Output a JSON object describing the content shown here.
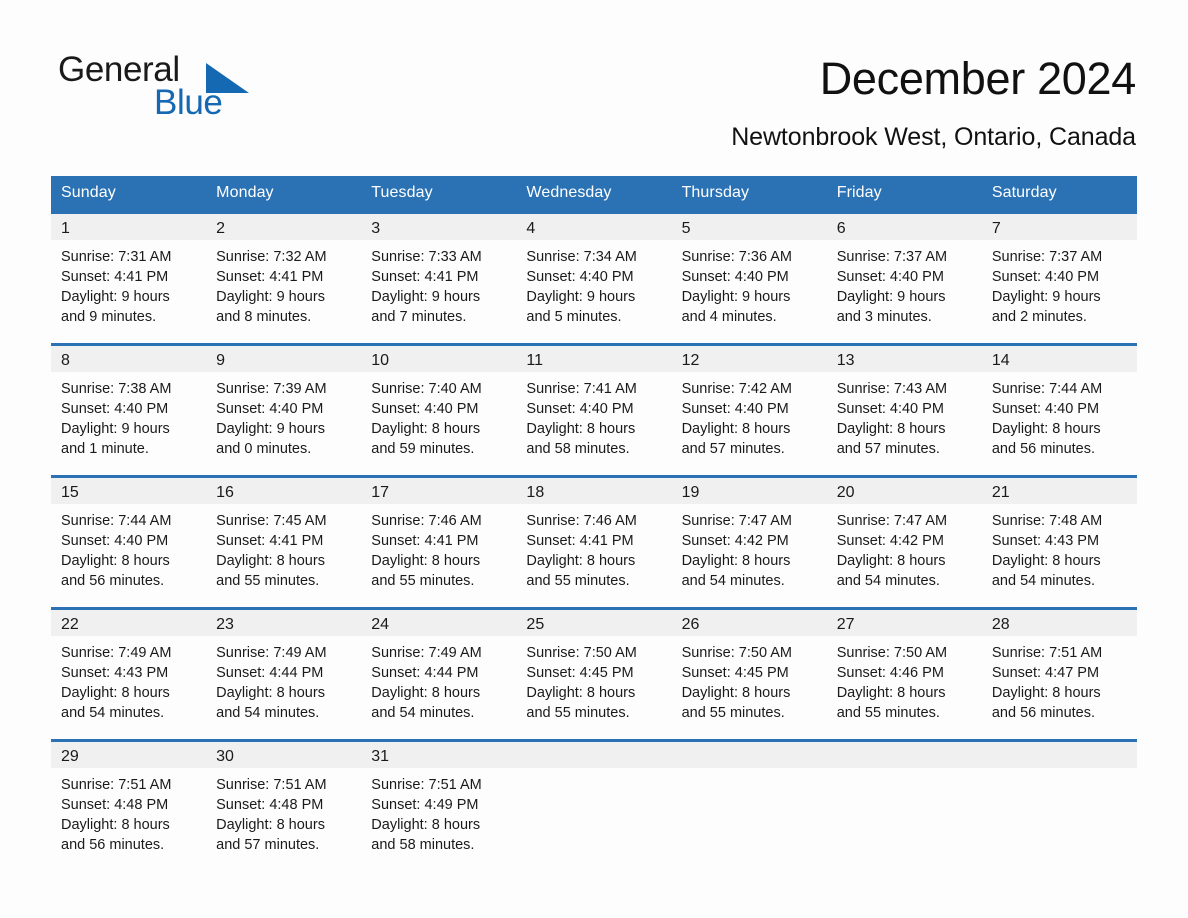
{
  "brand": {
    "name_top": "General",
    "name_bottom": "Blue",
    "triangle_icon": "blue-triangle-icon",
    "accent_color": "#1569b2"
  },
  "header": {
    "title": "December 2024",
    "subtitle": "Newtonbrook West, Ontario, Canada"
  },
  "theme": {
    "header_blue": "#2b72b4",
    "row_rule_blue": "#2b72b4",
    "daynum_band": "#f0f0f0",
    "page_background": "#fdfdfd"
  },
  "calendar": {
    "weekday_headers": [
      "Sunday",
      "Monday",
      "Tuesday",
      "Wednesday",
      "Thursday",
      "Friday",
      "Saturday"
    ],
    "weeks": [
      [
        {
          "day": "1",
          "sunrise": "Sunrise: 7:31 AM",
          "sunset": "Sunset: 4:41 PM",
          "daylight_line1": "Daylight: 9 hours",
          "daylight_line2": "and 9 minutes."
        },
        {
          "day": "2",
          "sunrise": "Sunrise: 7:32 AM",
          "sunset": "Sunset: 4:41 PM",
          "daylight_line1": "Daylight: 9 hours",
          "daylight_line2": "and 8 minutes."
        },
        {
          "day": "3",
          "sunrise": "Sunrise: 7:33 AM",
          "sunset": "Sunset: 4:41 PM",
          "daylight_line1": "Daylight: 9 hours",
          "daylight_line2": "and 7 minutes."
        },
        {
          "day": "4",
          "sunrise": "Sunrise: 7:34 AM",
          "sunset": "Sunset: 4:40 PM",
          "daylight_line1": "Daylight: 9 hours",
          "daylight_line2": "and 5 minutes."
        },
        {
          "day": "5",
          "sunrise": "Sunrise: 7:36 AM",
          "sunset": "Sunset: 4:40 PM",
          "daylight_line1": "Daylight: 9 hours",
          "daylight_line2": "and 4 minutes."
        },
        {
          "day": "6",
          "sunrise": "Sunrise: 7:37 AM",
          "sunset": "Sunset: 4:40 PM",
          "daylight_line1": "Daylight: 9 hours",
          "daylight_line2": "and 3 minutes."
        },
        {
          "day": "7",
          "sunrise": "Sunrise: 7:37 AM",
          "sunset": "Sunset: 4:40 PM",
          "daylight_line1": "Daylight: 9 hours",
          "daylight_line2": "and 2 minutes."
        }
      ],
      [
        {
          "day": "8",
          "sunrise": "Sunrise: 7:38 AM",
          "sunset": "Sunset: 4:40 PM",
          "daylight_line1": "Daylight: 9 hours",
          "daylight_line2": "and 1 minute."
        },
        {
          "day": "9",
          "sunrise": "Sunrise: 7:39 AM",
          "sunset": "Sunset: 4:40 PM",
          "daylight_line1": "Daylight: 9 hours",
          "daylight_line2": "and 0 minutes."
        },
        {
          "day": "10",
          "sunrise": "Sunrise: 7:40 AM",
          "sunset": "Sunset: 4:40 PM",
          "daylight_line1": "Daylight: 8 hours",
          "daylight_line2": "and 59 minutes."
        },
        {
          "day": "11",
          "sunrise": "Sunrise: 7:41 AM",
          "sunset": "Sunset: 4:40 PM",
          "daylight_line1": "Daylight: 8 hours",
          "daylight_line2": "and 58 minutes."
        },
        {
          "day": "12",
          "sunrise": "Sunrise: 7:42 AM",
          "sunset": "Sunset: 4:40 PM",
          "daylight_line1": "Daylight: 8 hours",
          "daylight_line2": "and 57 minutes."
        },
        {
          "day": "13",
          "sunrise": "Sunrise: 7:43 AM",
          "sunset": "Sunset: 4:40 PM",
          "daylight_line1": "Daylight: 8 hours",
          "daylight_line2": "and 57 minutes."
        },
        {
          "day": "14",
          "sunrise": "Sunrise: 7:44 AM",
          "sunset": "Sunset: 4:40 PM",
          "daylight_line1": "Daylight: 8 hours",
          "daylight_line2": "and 56 minutes."
        }
      ],
      [
        {
          "day": "15",
          "sunrise": "Sunrise: 7:44 AM",
          "sunset": "Sunset: 4:40 PM",
          "daylight_line1": "Daylight: 8 hours",
          "daylight_line2": "and 56 minutes."
        },
        {
          "day": "16",
          "sunrise": "Sunrise: 7:45 AM",
          "sunset": "Sunset: 4:41 PM",
          "daylight_line1": "Daylight: 8 hours",
          "daylight_line2": "and 55 minutes."
        },
        {
          "day": "17",
          "sunrise": "Sunrise: 7:46 AM",
          "sunset": "Sunset: 4:41 PM",
          "daylight_line1": "Daylight: 8 hours",
          "daylight_line2": "and 55 minutes."
        },
        {
          "day": "18",
          "sunrise": "Sunrise: 7:46 AM",
          "sunset": "Sunset: 4:41 PM",
          "daylight_line1": "Daylight: 8 hours",
          "daylight_line2": "and 55 minutes."
        },
        {
          "day": "19",
          "sunrise": "Sunrise: 7:47 AM",
          "sunset": "Sunset: 4:42 PM",
          "daylight_line1": "Daylight: 8 hours",
          "daylight_line2": "and 54 minutes."
        },
        {
          "day": "20",
          "sunrise": "Sunrise: 7:47 AM",
          "sunset": "Sunset: 4:42 PM",
          "daylight_line1": "Daylight: 8 hours",
          "daylight_line2": "and 54 minutes."
        },
        {
          "day": "21",
          "sunrise": "Sunrise: 7:48 AM",
          "sunset": "Sunset: 4:43 PM",
          "daylight_line1": "Daylight: 8 hours",
          "daylight_line2": "and 54 minutes."
        }
      ],
      [
        {
          "day": "22",
          "sunrise": "Sunrise: 7:49 AM",
          "sunset": "Sunset: 4:43 PM",
          "daylight_line1": "Daylight: 8 hours",
          "daylight_line2": "and 54 minutes."
        },
        {
          "day": "23",
          "sunrise": "Sunrise: 7:49 AM",
          "sunset": "Sunset: 4:44 PM",
          "daylight_line1": "Daylight: 8 hours",
          "daylight_line2": "and 54 minutes."
        },
        {
          "day": "24",
          "sunrise": "Sunrise: 7:49 AM",
          "sunset": "Sunset: 4:44 PM",
          "daylight_line1": "Daylight: 8 hours",
          "daylight_line2": "and 54 minutes."
        },
        {
          "day": "25",
          "sunrise": "Sunrise: 7:50 AM",
          "sunset": "Sunset: 4:45 PM",
          "daylight_line1": "Daylight: 8 hours",
          "daylight_line2": "and 55 minutes."
        },
        {
          "day": "26",
          "sunrise": "Sunrise: 7:50 AM",
          "sunset": "Sunset: 4:45 PM",
          "daylight_line1": "Daylight: 8 hours",
          "daylight_line2": "and 55 minutes."
        },
        {
          "day": "27",
          "sunrise": "Sunrise: 7:50 AM",
          "sunset": "Sunset: 4:46 PM",
          "daylight_line1": "Daylight: 8 hours",
          "daylight_line2": "and 55 minutes."
        },
        {
          "day": "28",
          "sunrise": "Sunrise: 7:51 AM",
          "sunset": "Sunset: 4:47 PM",
          "daylight_line1": "Daylight: 8 hours",
          "daylight_line2": "and 56 minutes."
        }
      ],
      [
        {
          "day": "29",
          "sunrise": "Sunrise: 7:51 AM",
          "sunset": "Sunset: 4:48 PM",
          "daylight_line1": "Daylight: 8 hours",
          "daylight_line2": "and 56 minutes."
        },
        {
          "day": "30",
          "sunrise": "Sunrise: 7:51 AM",
          "sunset": "Sunset: 4:48 PM",
          "daylight_line1": "Daylight: 8 hours",
          "daylight_line2": "and 57 minutes."
        },
        {
          "day": "31",
          "sunrise": "Sunrise: 7:51 AM",
          "sunset": "Sunset: 4:49 PM",
          "daylight_line1": "Daylight: 8 hours",
          "daylight_line2": "and 58 minutes."
        },
        {
          "day": "",
          "sunrise": "",
          "sunset": "",
          "daylight_line1": "",
          "daylight_line2": ""
        },
        {
          "day": "",
          "sunrise": "",
          "sunset": "",
          "daylight_line1": "",
          "daylight_line2": ""
        },
        {
          "day": "",
          "sunrise": "",
          "sunset": "",
          "daylight_line1": "",
          "daylight_line2": ""
        },
        {
          "day": "",
          "sunrise": "",
          "sunset": "",
          "daylight_line1": "",
          "daylight_line2": ""
        }
      ]
    ]
  }
}
